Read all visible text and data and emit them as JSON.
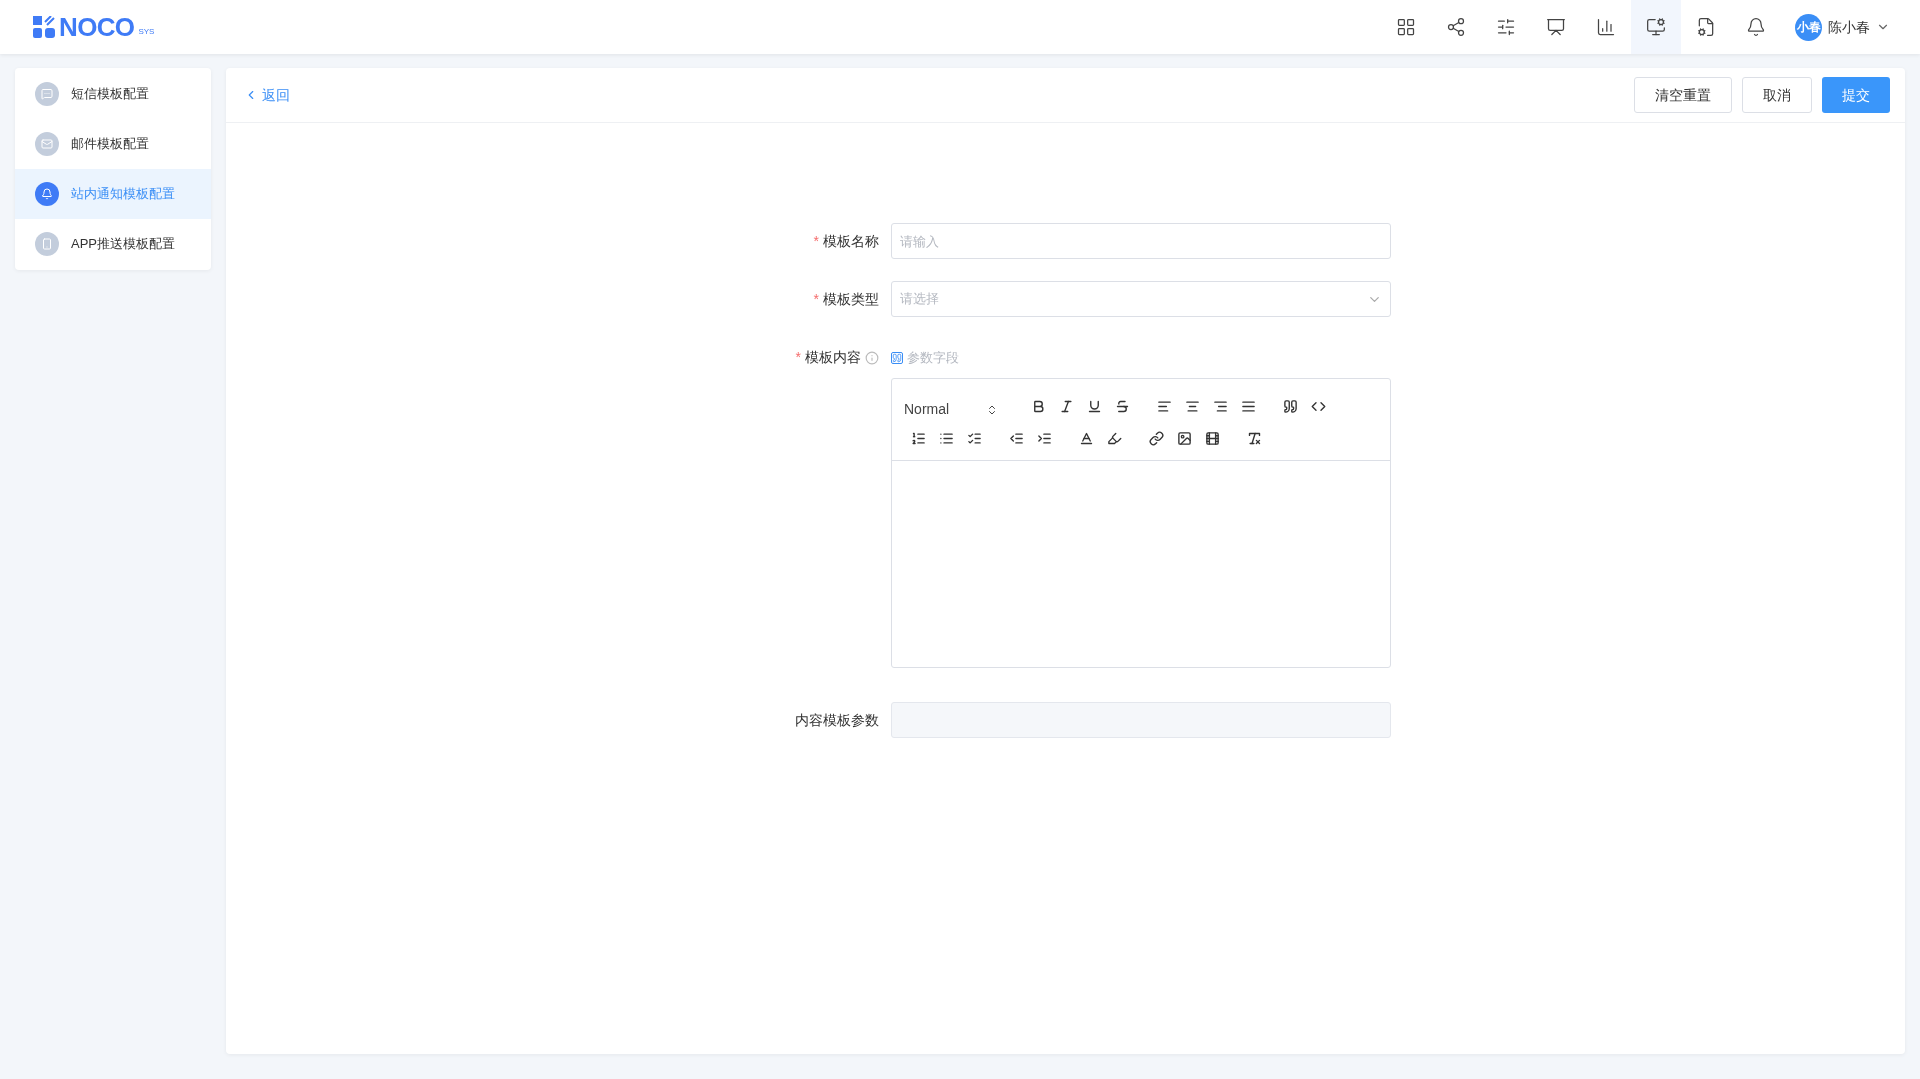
{
  "header": {
    "logo": {
      "name": "NOCO",
      "sup": "SYS"
    },
    "toolbar_icons": [
      {
        "selected": false
      },
      {
        "selected": false
      },
      {
        "selected": false
      },
      {
        "selected": false
      },
      {
        "selected": false
      },
      {
        "selected": true
      },
      {
        "selected": false
      },
      {
        "selected": false
      }
    ],
    "user": {
      "avatar": "小春",
      "name": "陈小春"
    }
  },
  "sidebar": {
    "items": [
      {
        "label": "短信模板配置",
        "selected": false
      },
      {
        "label": "邮件模板配置",
        "selected": false
      },
      {
        "label": "站内通知模板配置",
        "selected": true
      },
      {
        "label": "APP推送模板配置",
        "selected": false
      }
    ]
  },
  "topbar": {
    "back": "返回",
    "buttons": [
      {
        "label": "清空重置",
        "kind": "default"
      },
      {
        "label": "取消",
        "kind": "default"
      },
      {
        "label": "提交",
        "kind": "primary"
      }
    ]
  },
  "form": {
    "name": {
      "label": "模板名称",
      "required_mark": "*",
      "placeholder": "请输入"
    },
    "type": {
      "label": "模板类型",
      "required_mark": "*",
      "placeholder": "请选择"
    },
    "content": {
      "label": "模板内容",
      "required_mark": "*",
      "param_link": "参数字段",
      "editor": {
        "heading_select": "Normal"
      }
    },
    "params": {
      "label": "内容模板参数"
    }
  }
}
